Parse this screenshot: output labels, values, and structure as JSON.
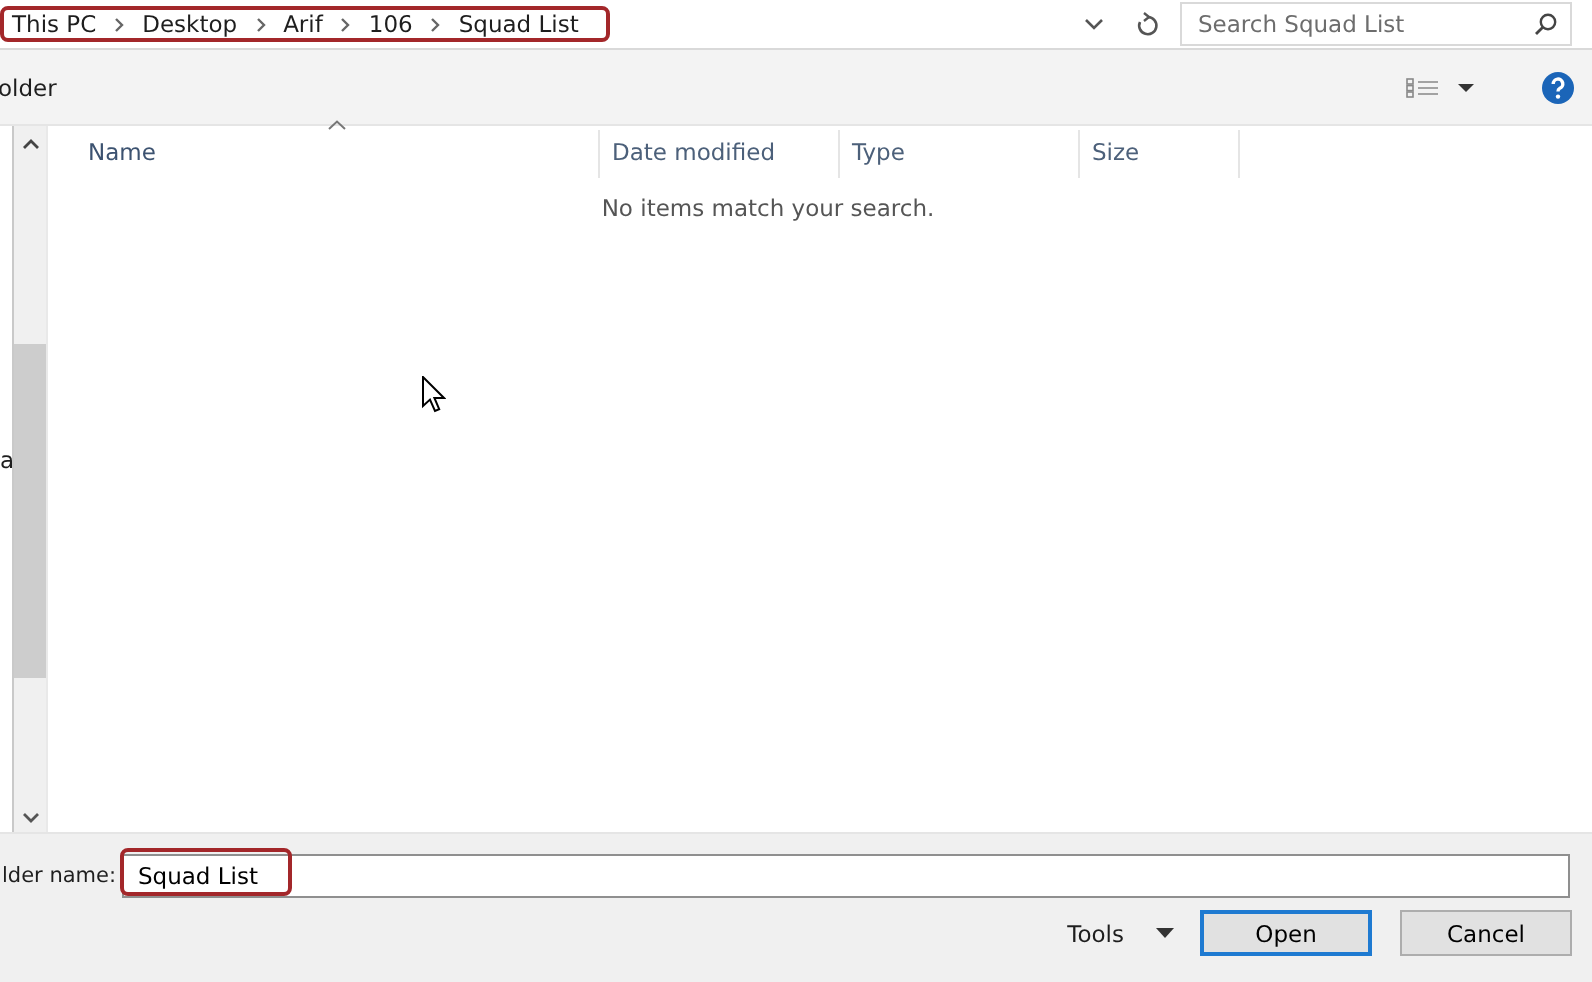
{
  "address": {
    "breadcrumbs": [
      "This PC",
      "Desktop",
      "Arif",
      "106",
      "Squad List"
    ],
    "highlighted": true
  },
  "search": {
    "placeholder": "Search Squad List"
  },
  "toolbar": {
    "label": "older"
  },
  "nav": {
    "items": [
      "a"
    ]
  },
  "columns": [
    {
      "label": "Name",
      "sorted": true
    },
    {
      "label": "Date modified",
      "sorted": false
    },
    {
      "label": "Type",
      "sorted": false
    },
    {
      "label": "Size",
      "sorted": false
    }
  ],
  "empty_message": "No items match your search.",
  "footer": {
    "label": "lder name:",
    "value": "Squad List",
    "highlighted": true,
    "tools": "Tools",
    "buttons": [
      {
        "label": "Open",
        "default": true
      },
      {
        "label": "Cancel",
        "default": false
      }
    ]
  }
}
